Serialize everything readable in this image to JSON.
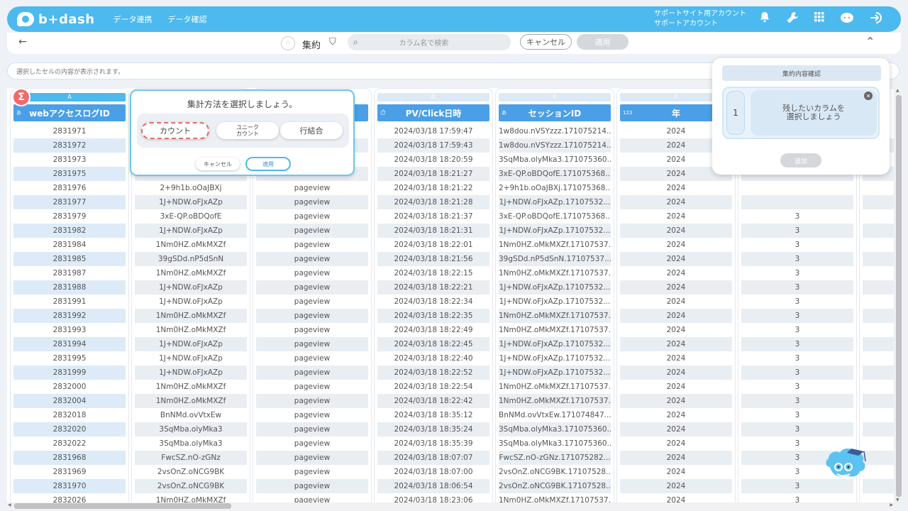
{
  "header": {
    "logo": "b+dash",
    "nav": [
      "データ連携",
      "データ確認"
    ],
    "account_line1": "サポートサイト用アカウント",
    "account_line2": "サポートアカウント"
  },
  "toolbar": {
    "aggregate_label": "集約",
    "search_placeholder": "カラム名で検索",
    "cancel_label": "キャンセル",
    "apply_label": "適用"
  },
  "cell_bar": {
    "placeholder": "選択したセルの内容が表示されます。"
  },
  "popup": {
    "title": "集計方法を選択しましょう。",
    "options": [
      "カウント",
      "ユニーク\nカウント",
      "行結合"
    ],
    "cancel_label": "キャンセル",
    "apply_label": "適用"
  },
  "panel": {
    "title": "集約内容確認",
    "number": "1",
    "message": "残したいカラムを\n選択しましょう",
    "add_label": "追加"
  },
  "table": {
    "columns": [
      {
        "letter": "A",
        "header": "webアクセスログID",
        "type": "あ"
      },
      {
        "letter": "",
        "header": "",
        "type": ""
      },
      {
        "letter": "",
        "header": "",
        "type": ""
      },
      {
        "letter": "D",
        "header": "PV/Click日時",
        "type": "clock"
      },
      {
        "letter": "E",
        "header": "セッションID",
        "type": "あ"
      },
      {
        "letter": "F",
        "header": "年",
        "type": "123"
      },
      {
        "letter": "",
        "header": "",
        "type": ""
      }
    ],
    "col_a": [
      "2831971",
      "2831972",
      "2831973",
      "2831975",
      "2831976",
      "2831977",
      "2831979",
      "2831982",
      "2831984",
      "2831985",
      "2831987",
      "2831988",
      "2831991",
      "2831992",
      "2831993",
      "2831994",
      "2831995",
      "2831999",
      "2832000",
      "2832004",
      "2832018",
      "2832020",
      "2832022",
      "2831968",
      "2831969",
      "2831970",
      "2832026"
    ],
    "col_b": [
      "",
      "",
      "",
      "",
      "2+9h1b.oOaJBXj",
      "1J+NDW.oFJxAZp",
      "3xE-QP.oBDQofE",
      "1J+NDW.oFJxAZp",
      "1Nm0HZ.oMkMXZf",
      "39gSDd.nP5dSnN",
      "1Nm0HZ.oMkMXZf",
      "1J+NDW.oFJxAZp",
      "1J+NDW.oFJxAZp",
      "1Nm0HZ.oMkMXZf",
      "1Nm0HZ.oMkMXZf",
      "1J+NDW.oFJxAZp",
      "1J+NDW.oFJxAZp",
      "1J+NDW.oFJxAZp",
      "1Nm0HZ.oMkMXZf",
      "1Nm0HZ.oMkMXZf",
      "BnNMd.ovVtxEw",
      "3SqMba.olyMka3",
      "3SqMba.olyMka3",
      "FwcSZ.nO-zGNz",
      "2vsOnZ.oNCG9BK",
      "2vsOnZ.oNCG9BK",
      "1Nm0HZ.oMkMXZf"
    ],
    "col_c_value": "pageview",
    "col_d": [
      "2024/03/18 17:59:47",
      "2024/03/18 17:59:43",
      "2024/03/18 18:20:59",
      "2024/03/18 18:21:27",
      "2024/03/18 18:21:22",
      "2024/03/18 18:21:28",
      "2024/03/18 18:21:37",
      "2024/03/18 18:21:31",
      "2024/03/18 18:22:01",
      "2024/03/18 18:21:56",
      "2024/03/18 18:22:15",
      "2024/03/18 18:22:21",
      "2024/03/18 18:22:34",
      "2024/03/18 18:22:35",
      "2024/03/18 18:22:49",
      "2024/03/18 18:22:45",
      "2024/03/18 18:22:40",
      "2024/03/18 18:22:52",
      "2024/03/18 18:22:54",
      "2024/03/18 18:22:42",
      "2024/03/18 18:35:12",
      "2024/03/18 18:35:24",
      "2024/03/18 18:35:39",
      "2024/03/18 18:07:07",
      "2024/03/18 18:07:00",
      "2024/03/18 18:06:54",
      "2024/03/18 18:23:06"
    ],
    "col_e": [
      "1w8dou.nVSYzzz.171075214...",
      "1w8dou.nVSYzzz.171075214...",
      "3SqMba.olyMka3.171075360...",
      "3xE-QP.oBDQofE.171075368...",
      "2+9h1b.oOaJBXj.171075368...",
      "1J+NDW.oFJxAZp.17107532...",
      "3xE-QP.oBDQofE.171075368...",
      "1J+NDW.oFJxAZp.17107532...",
      "1Nm0HZ.oMkMXZf.17107537...",
      "39gSDd.nP5dSnN.17107537...",
      "1Nm0HZ.oMkMXZf.17107537...",
      "1J+NDW.oFJxAZp.17107532...",
      "1J+NDW.oFJxAZp.17107532...",
      "1Nm0HZ.oMkMXZf.17107537...",
      "1Nm0HZ.oMkMXZf.17107537...",
      "1J+NDW.oFJxAZp.17107532...",
      "1J+NDW.oFJxAZp.17107532...",
      "1J+NDW.oFJxAZp.17107532...",
      "1Nm0HZ.oMkMXZf.17107537...",
      "1Nm0HZ.oMkMXZf.17107537...",
      "BnNMd.ovVtxEw.171074847...",
      "3SqMba.olyMka3.171075360...",
      "3SqMba.olyMka3.171075360...",
      "FwcSZ.nO-zGNz.171075282...",
      "2vsOnZ.oNCG9BK.17107528...",
      "2vsOnZ.oNCG9BK.17107528...",
      "1Nm0HZ.oMkMXZf.17107537..."
    ],
    "col_f_value": "2024",
    "col_g_value": "3"
  },
  "colors": {
    "brand": "#4cb9ef",
    "header_blue": "#4a9fe6",
    "accent_red": "#ee6b6b"
  },
  "icons": [
    "bell-icon",
    "wrench-icon",
    "grid-icon",
    "support-icon",
    "logout-icon",
    "back-arrow-icon",
    "aggregate-icon",
    "shield-icon",
    "search-icon",
    "chevron-up-icon",
    "sigma-icon",
    "close-icon",
    "mascot-icon"
  ]
}
